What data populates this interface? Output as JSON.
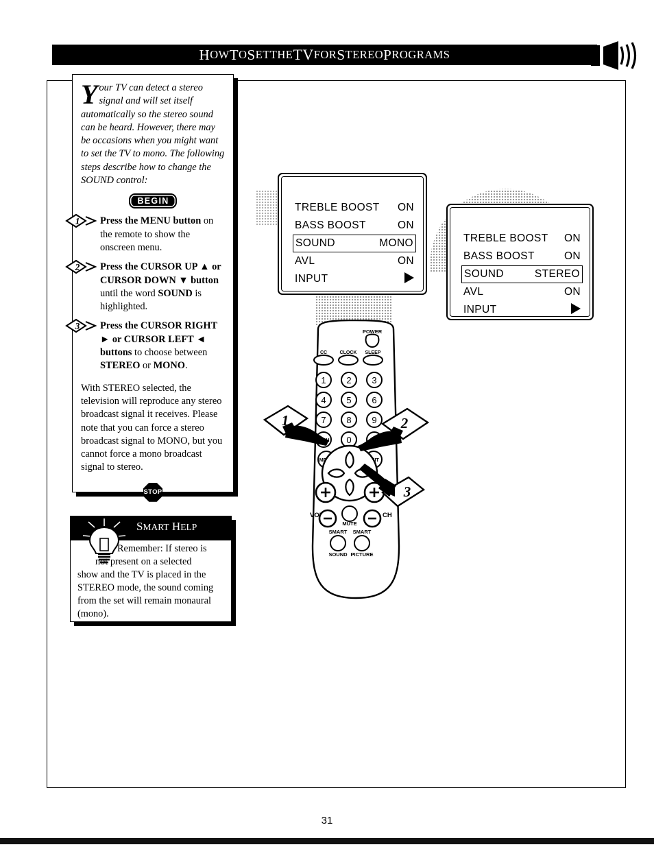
{
  "header": {
    "title_parts": [
      {
        "t": "H",
        "s": "cap"
      },
      {
        "t": "OW",
        "s": "sc"
      },
      {
        "t": " T",
        "s": "cap"
      },
      {
        "t": "O",
        "s": "sc"
      },
      {
        "t": " S",
        "s": "cap"
      },
      {
        "t": "ET",
        "s": "sc"
      },
      {
        "t": " ",
        "s": "sc"
      },
      {
        "t": "THE",
        "s": "sc"
      },
      {
        "t": " TV",
        "s": "big"
      },
      {
        "t": " ",
        "s": "sc"
      },
      {
        "t": "FOR",
        "s": "sc"
      },
      {
        "t": " S",
        "s": "cap"
      },
      {
        "t": "TEREO",
        "s": "sc"
      },
      {
        "t": " P",
        "s": "cap"
      },
      {
        "t": "ROGRAMS",
        "s": "sc"
      }
    ],
    "title_plain": "HOW TO SET THE TV FOR STEREO PROGRAMS",
    "icon": "speaker-sound-icon"
  },
  "instructions": {
    "dropcap": "Y",
    "intro": "our TV can detect a stereo signal and will set itself automatically so the stereo sound can be heard. However, there may be occasions when you might want to set the TV to mono. The following steps describe how to change the SOUND control:",
    "begin_label": "BEGIN",
    "stop_label": "STOP",
    "steps": [
      {
        "num": "1",
        "html": "<b>Press the MENU button</b> on the remote to show the onscreen menu."
      },
      {
        "num": "2",
        "html": "<b>Press the CURSOR UP &#9650; or CURSOR DOWN &#9660; button</b> until the word <b>SOUND</b> is highlighted."
      },
      {
        "num": "3",
        "html": "<b>Press the CURSOR RIGHT &#9658; or CURSOR LEFT &#9668; buttons</b> to choose between <b>STEREO</b> or <b>MONO</b>."
      }
    ],
    "closing": "With STEREO selected, the television will reproduce any stereo broadcast signal it receives. Please note that you can force a stereo broadcast signal to MONO, but you cannot force a mono broadcast signal to stereo."
  },
  "smart_help": {
    "title_parts": [
      {
        "t": "S",
        "s": "cap"
      },
      {
        "t": "MART",
        "s": "sc"
      },
      {
        "t": " H",
        "s": "cap"
      },
      {
        "t": "ELP",
        "s": "sc"
      }
    ],
    "title_plain": "SMART HELP",
    "icon": "lightbulb-icon",
    "line1": "Remember: If stereo is",
    "line2": "not present on a selected",
    "body": "show and the TV is placed in the STEREO mode, the sound coming from the set will remain monaural (mono)."
  },
  "tv_screens": [
    {
      "id": "tv-screen-mono",
      "rows": [
        {
          "label": "TREBLE BOOST",
          "value": "ON",
          "selected": false,
          "arrow": false
        },
        {
          "label": "BASS BOOST",
          "value": "ON",
          "selected": false,
          "arrow": false
        },
        {
          "label": "SOUND",
          "value": "MONO",
          "selected": true,
          "arrow": false
        },
        {
          "label": "AVL",
          "value": "ON",
          "selected": false,
          "arrow": false
        },
        {
          "label": "INPUT",
          "value": "",
          "selected": false,
          "arrow": true
        }
      ]
    },
    {
      "id": "tv-screen-stereo",
      "rows": [
        {
          "label": "TREBLE BOOST",
          "value": "ON",
          "selected": false,
          "arrow": false
        },
        {
          "label": "BASS BOOST",
          "value": "ON",
          "selected": false,
          "arrow": false
        },
        {
          "label": "SOUND",
          "value": "STEREO",
          "selected": true,
          "arrow": false
        },
        {
          "label": "AVL",
          "value": "ON",
          "selected": false,
          "arrow": false
        },
        {
          "label": "INPUT",
          "value": "",
          "selected": false,
          "arrow": true
        }
      ]
    }
  ],
  "remote": {
    "power_label": "POWER",
    "top_buttons": [
      "CC",
      "CLOCK",
      "SLEEP"
    ],
    "keypad": [
      "1",
      "2",
      "3",
      "4",
      "5",
      "6",
      "7",
      "8",
      "9"
    ],
    "ach_label": "A/CH",
    "zero_label": "0",
    "menu_label": "MENU",
    "exit_label": "EXIT",
    "vol_label": "VOL",
    "ch_label": "CH",
    "mute_label": "MUTE",
    "smart_sound": [
      "SMART",
      "SOUND"
    ],
    "smart_picture": [
      "SMART",
      "PICTURE"
    ]
  },
  "callouts": [
    {
      "num": "1",
      "target": "menu-button"
    },
    {
      "num": "2",
      "target": "exit-area"
    },
    {
      "num": "3",
      "target": "cursor-right-button"
    }
  ],
  "footer": {
    "page_number": "31"
  },
  "colors": {
    "ink": "#000000",
    "paper": "#ffffff",
    "halftone": "#9a9a9a"
  }
}
